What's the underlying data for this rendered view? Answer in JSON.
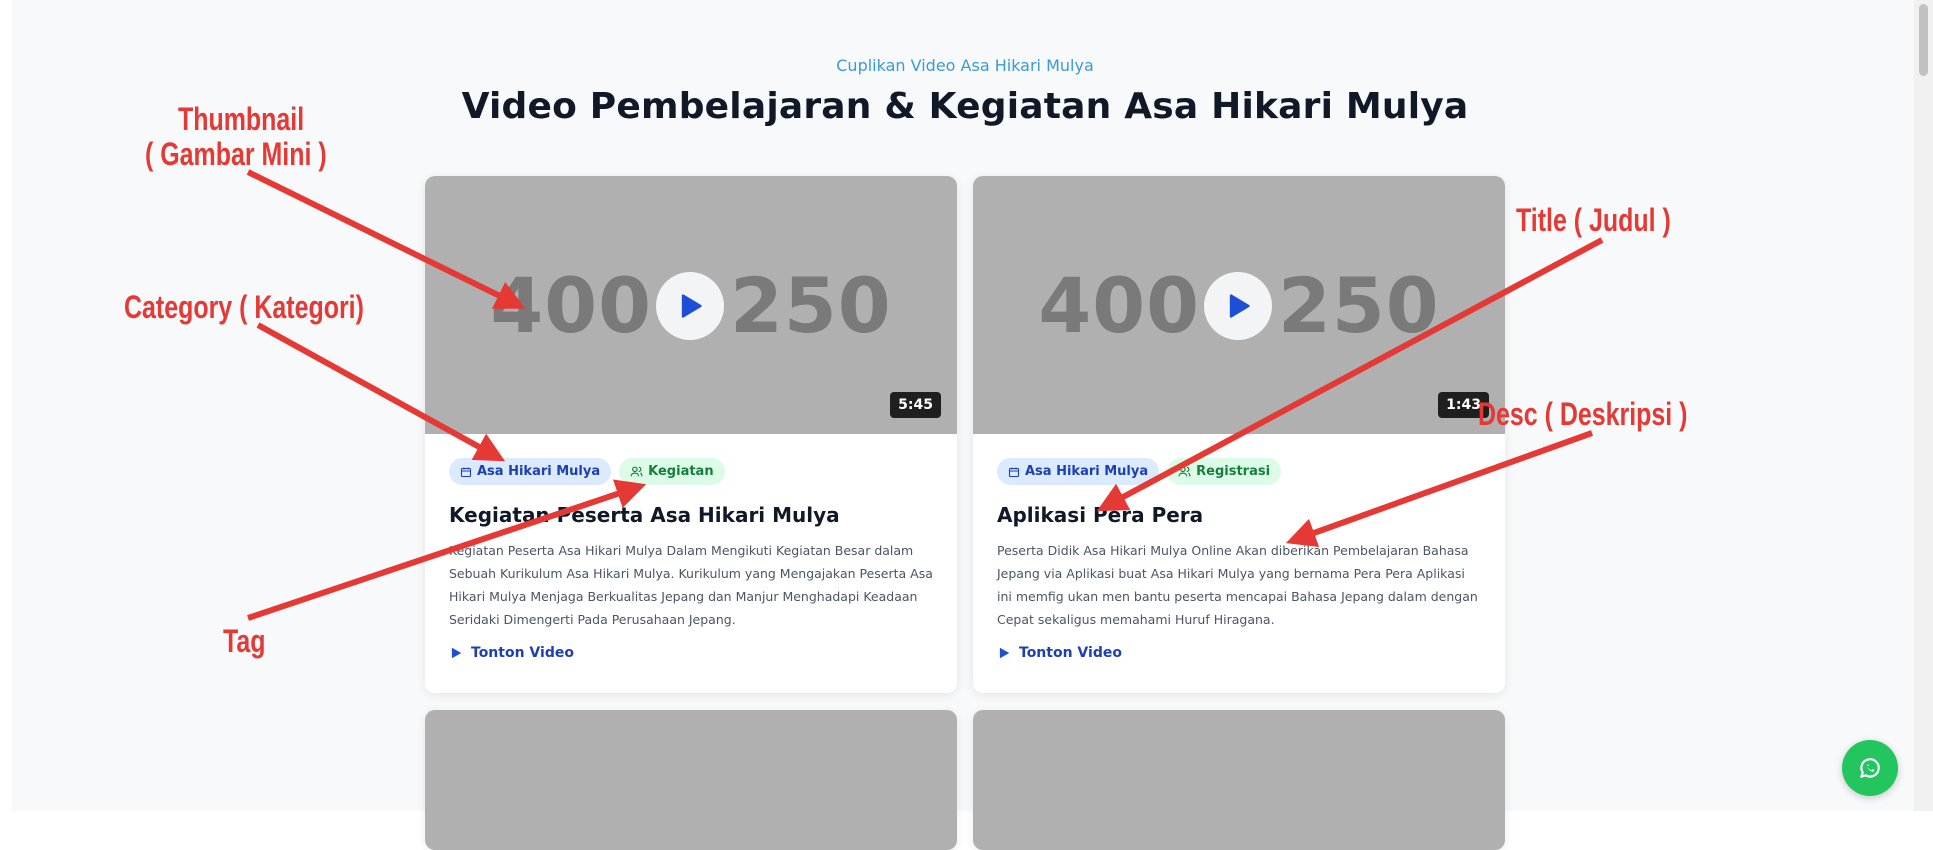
{
  "section": {
    "eyebrow": "Cuplikan Video Asa Hikari Mulya",
    "heading": "Video Pembelajaran & Kegiatan Asa Hikari Mulya"
  },
  "cards": [
    {
      "thumb_w": "400",
      "thumb_h": "250",
      "duration": "5:45",
      "category": "Asa Hikari Mulya",
      "tag": "Kegiatan",
      "title": "Kegiatan Peserta Asa Hikari Mulya",
      "desc": "Kegiatan Peserta Asa Hikari Mulya Dalam Mengikuti Kegiatan Besar dalam Sebuah Kurikulum Asa Hikari Mulya. Kurikulum yang Mengajakan Peserta Asa Hikari Mulya Menjaga Berkualitas Jepang dan Manjur Menghadapi Keadaan Seridaki Dimengerti Pada Perusahaan Jepang.",
      "cta": "Tonton Video"
    },
    {
      "thumb_w": "400",
      "thumb_h": "250",
      "duration": "1:43",
      "category": "Asa Hikari Mulya",
      "tag": "Registrasi",
      "title": "Aplikasi Pera Pera",
      "desc": "Peserta Didik Asa Hikari Mulya Online Akan diberikan Pembelajaran Bahasa Jepang via Aplikasi buat Asa Hikari Mulya yang bernama Pera Pera Aplikasi ini memfig ukan men bantu peserta mencapai Bahasa Jepang dalam dengan Cepat sekaligus memahami Huruf Hiragana.",
      "cta": "Tonton Video"
    }
  ],
  "annotations": {
    "thumbnail_line1": "Thumbnail",
    "thumbnail_line2": "( Gambar Mini )",
    "category": "Category ( Kategori)",
    "tag": "Tag",
    "title": "Title ( Judul )",
    "desc": "Desc ( Deskripsi )"
  },
  "icons": {
    "play": "play-icon",
    "calendar": "calendar-icon",
    "users": "users-icon",
    "whatsapp": "whatsapp-icon"
  },
  "colors": {
    "accent": "#1e40af",
    "annotation": "#e53935",
    "whatsapp": "#22c55e"
  }
}
